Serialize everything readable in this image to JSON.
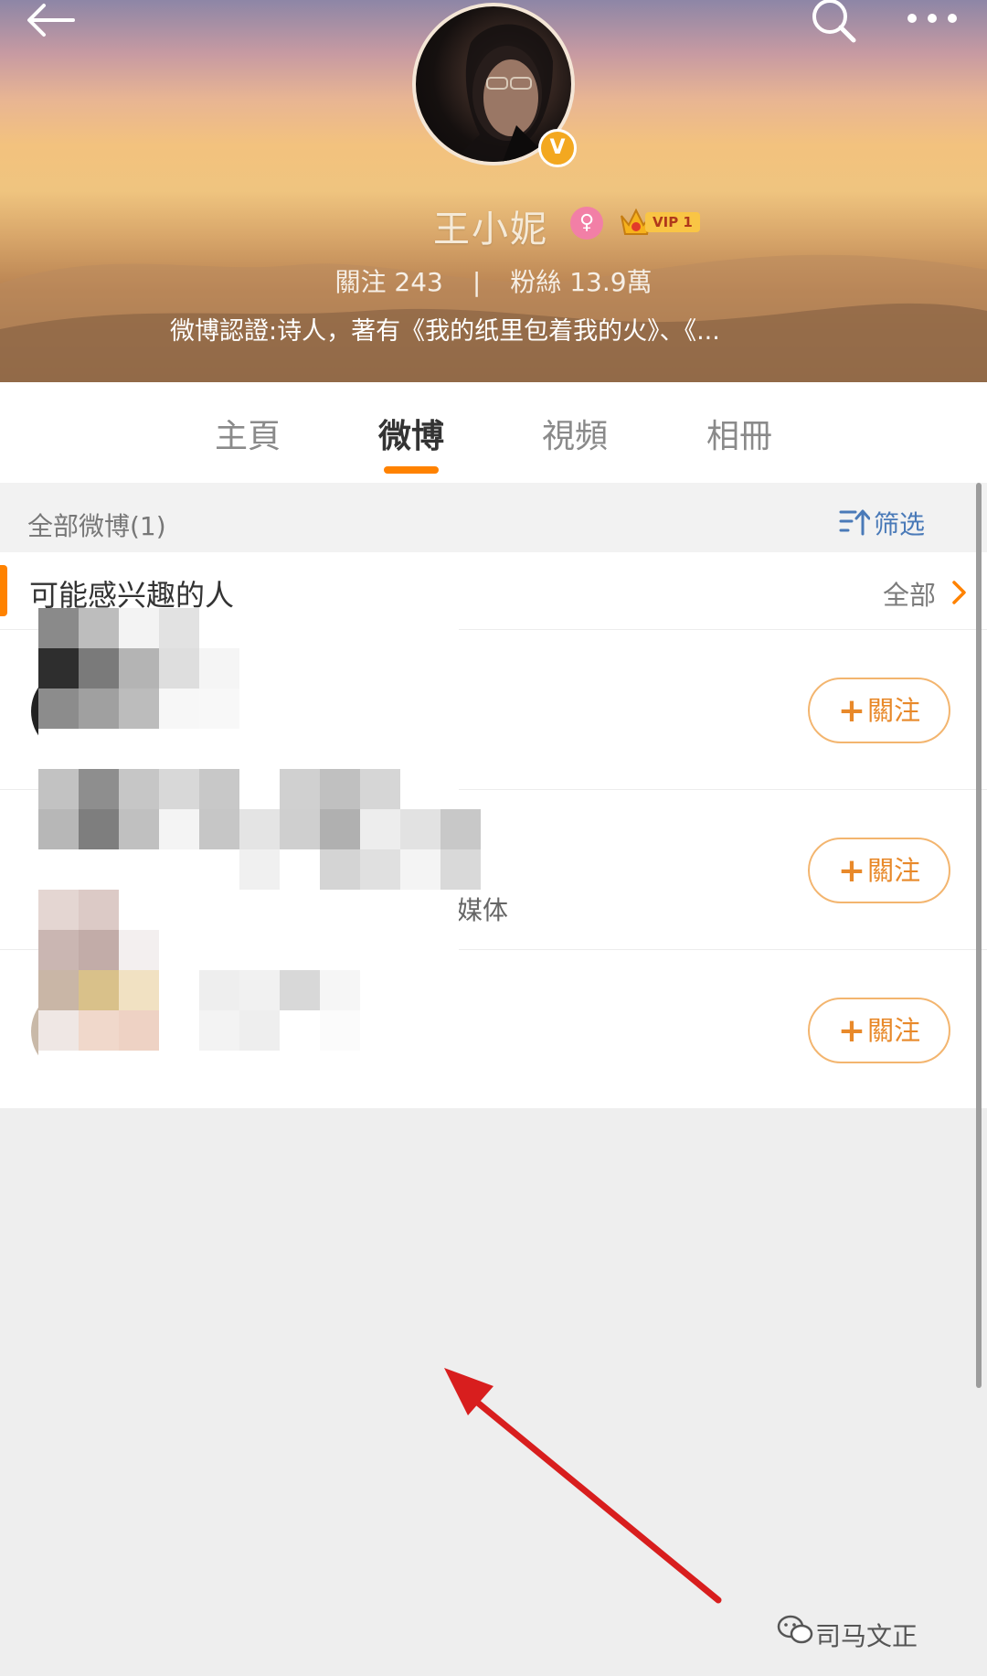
{
  "header": {
    "profile_name": "王小妮",
    "vip_label": "VIP 1",
    "following_label": "關注",
    "following_count": "243",
    "followers_label": "粉絲",
    "followers_count": "13.9萬",
    "stats_separator": "|",
    "bio": "微博認證:诗人，著有《我的纸里包着我的火》、《...",
    "verified_badge": "V"
  },
  "tabs": [
    {
      "label": "主頁"
    },
    {
      "label": "微博"
    },
    {
      "label": "視頻"
    },
    {
      "label": "相冊"
    }
  ],
  "active_tab": "微博",
  "filter_bar": {
    "title": "全部微博(1)",
    "filter_label": "筛选"
  },
  "suggestions": {
    "title": "可能感兴趣的人",
    "all_label": "全部",
    "items": [
      {
        "follow_label": "關注",
        "description": ""
      },
      {
        "follow_label": "關注",
        "description": "媒体"
      },
      {
        "follow_label": "關注",
        "description": ""
      }
    ]
  },
  "watermark": "司马文正",
  "colors": {
    "accent": "#ff8200",
    "follow_border": "#f3b56f",
    "link_blue": "#4a7ab8",
    "annotation_arrow": "#d81e1e"
  }
}
